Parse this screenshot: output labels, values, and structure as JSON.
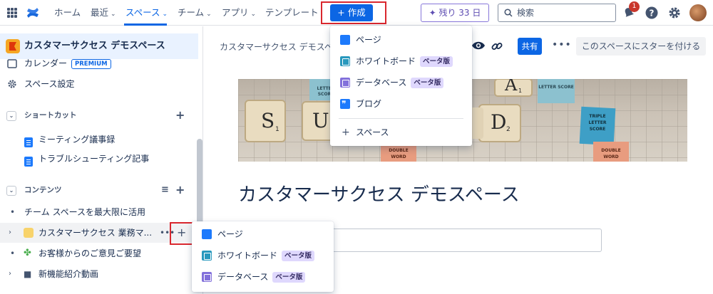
{
  "nav": {
    "items": [
      {
        "label": "ホーム",
        "chevron": false
      },
      {
        "label": "最近",
        "chevron": true
      },
      {
        "label": "スペース",
        "chevron": true,
        "active": true
      },
      {
        "label": "チーム",
        "chevron": true
      },
      {
        "label": "アプリ",
        "chevron": true
      },
      {
        "label": "テンプレート",
        "chevron": false
      }
    ],
    "create_label": "+ 作成",
    "trial_label": "残り 33 日",
    "search_placeholder": "検索",
    "notification_count": "1"
  },
  "sidebar": {
    "space_title": "カスタマーサクセス デモスペース",
    "calendar_label": "カレンダー",
    "premium_badge": "PREMIUM",
    "space_settings_label": "スペース設定",
    "shortcuts_heading": "ショートカット",
    "shortcuts": [
      {
        "label": "ミーティング議事録"
      },
      {
        "label": "トラブルシューティング記事"
      }
    ],
    "content_heading": "コンテンツ",
    "content_items": [
      {
        "label": "チーム スペースを最大限に活用"
      },
      {
        "label": "カスタマーサクセス 業務マ..."
      },
      {
        "label": "お客様からのご意見ご要望"
      },
      {
        "label": "新機能紹介動画"
      }
    ]
  },
  "main": {
    "breadcrumb": "カスタマーサクセス デモスペ",
    "share_label": "共有",
    "star_label": "このスペースにスターを付ける",
    "page_title": "カスタマーサクセス デモスペース",
    "cover_tiles": [
      {
        "letter": "S",
        "sub": "1"
      },
      {
        "letter": "U",
        "sub": ""
      },
      {
        "letter": "D",
        "sub": "2"
      },
      {
        "letter": "A",
        "sub": "1"
      }
    ],
    "cover_labels": {
      "letter_score": "LETTER SCORE",
      "triple_letter_score": "TRIPLE LETTER SCORE",
      "double_word": "DOUBLE WORD"
    }
  },
  "create_menu": {
    "items": [
      {
        "label": "ページ",
        "beta": ""
      },
      {
        "label": "ホワイトボード",
        "beta": "ベータ版"
      },
      {
        "label": "データベース",
        "beta": "ベータ版"
      },
      {
        "label": "ブログ",
        "beta": ""
      }
    ],
    "space_label": "スペース"
  },
  "sidebar_menu": {
    "items": [
      {
        "label": "ページ",
        "beta": ""
      },
      {
        "label": "ホワイトボード",
        "beta": "ベータ版"
      },
      {
        "label": "データベース",
        "beta": "ベータ版"
      }
    ]
  },
  "colors": {
    "accent": "#0c66e4",
    "highlight_box": "#d9272e",
    "beta_badge": "#dfd8fd"
  }
}
